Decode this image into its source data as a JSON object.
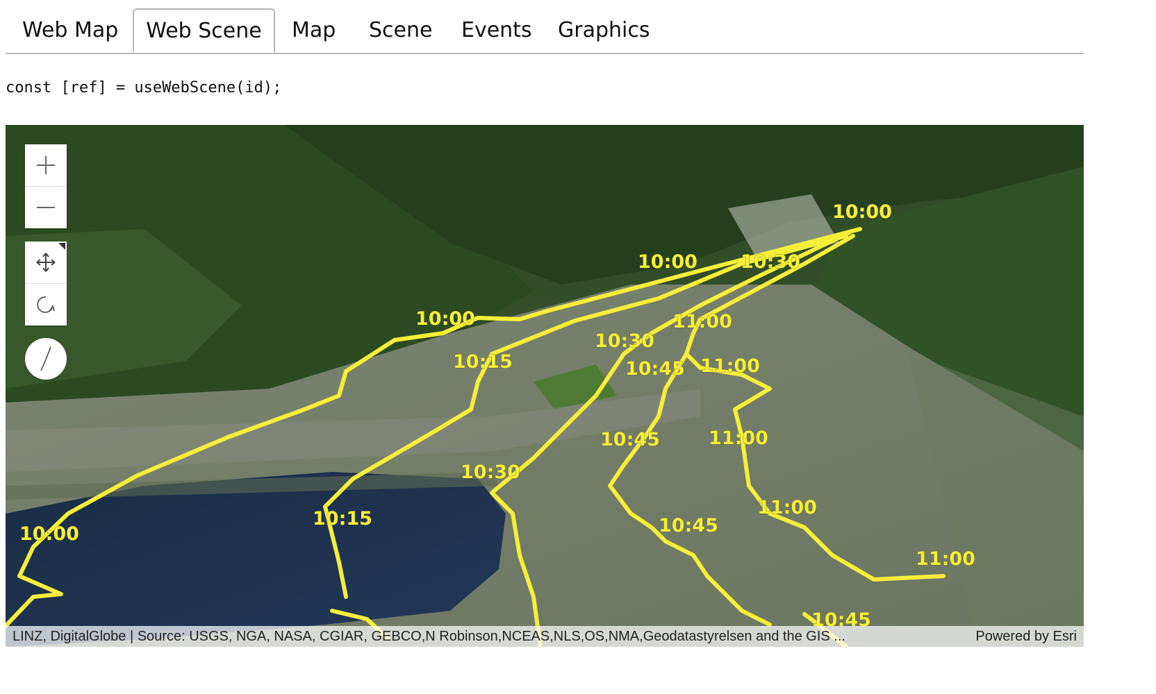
{
  "tabs": [
    {
      "label": "Web Map",
      "active": false
    },
    {
      "label": "Web Scene",
      "active": true
    },
    {
      "label": "Map",
      "active": false
    },
    {
      "label": "Scene",
      "active": false
    },
    {
      "label": "Events",
      "active": false
    },
    {
      "label": "Graphics",
      "active": false
    }
  ],
  "code_line": "const [ref] = useWebScene(id);",
  "scene": {
    "controls": {
      "zoom_in_icon": "plus-icon",
      "zoom_out_icon": "minus-icon",
      "pan_icon": "pan-arrows-icon",
      "rotate_icon": "rotate-icon",
      "compass_icon": "compass-icon"
    },
    "track_color": "#f5ef3a",
    "time_labels": [
      "10:00",
      "10:00",
      "10:00",
      "10:00",
      "10:30",
      "11:00",
      "10:30",
      "10:15",
      "10:45",
      "11:00",
      "10:45",
      "11:00",
      "10:30",
      "10:15",
      "10:45",
      "11:00",
      "11:00",
      "10:45"
    ],
    "attribution": {
      "source": "LINZ, DigitalGlobe | Source: USGS, NGA, NASA, CGIAR, GEBCO,N Robinson,NCEAS,NLS,OS,NMA,Geodatastyrelsen and the GIS ...",
      "powered_by": "Powered by Esri"
    }
  }
}
